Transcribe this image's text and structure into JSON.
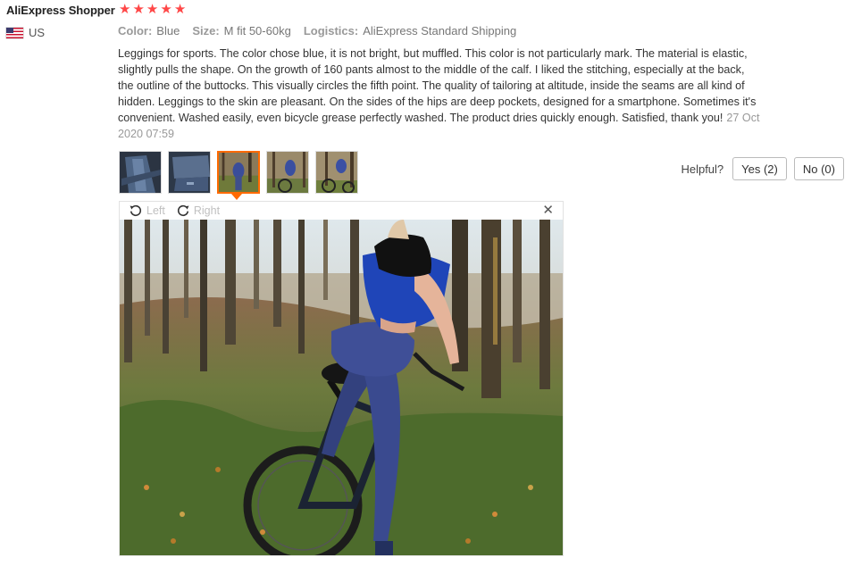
{
  "review": {
    "reviewer": "AliExpress Shopper",
    "rating": 5,
    "star_color": "#ff4747",
    "country": "US",
    "country_flag": "us-flag-icon",
    "attributes": [
      {
        "label": "Color:",
        "value": "Blue"
      },
      {
        "label": "Size:",
        "value": "M fit 50-60kg"
      },
      {
        "label": "Logistics:",
        "value": "AliExpress Standard Shipping"
      }
    ],
    "text": "Leggings for sports. The color chose blue, it is not bright, but muffled. This color is not particularly mark. The material is elastic, slightly pulls the shape. On the growth of 160 pants almost to the middle of the calf. I liked the stitching, especially at the back, the outline of the buttocks. This visually circles the fifth point. The quality of tailoring at altitude, inside the seams are all kind of hidden. Leggings to the skin are pleasant. On the sides of the hips are deep pockets, designed for a smartphone. Sometimes it's convenient. Washed easily, even bicycle grease perfectly washed. The product dries quickly enough. Satisfied, thank you!",
    "date": "27 Oct 2020 07:59"
  },
  "thumbnails": {
    "count": 5,
    "selected_index": 2,
    "accent": "#ff6a00"
  },
  "helpful": {
    "label": "Helpful?",
    "yes": "Yes (2)",
    "no": "No (0)"
  },
  "viewer": {
    "rotate_left": "Left",
    "rotate_right": "Right",
    "close_icon": "close-icon"
  }
}
